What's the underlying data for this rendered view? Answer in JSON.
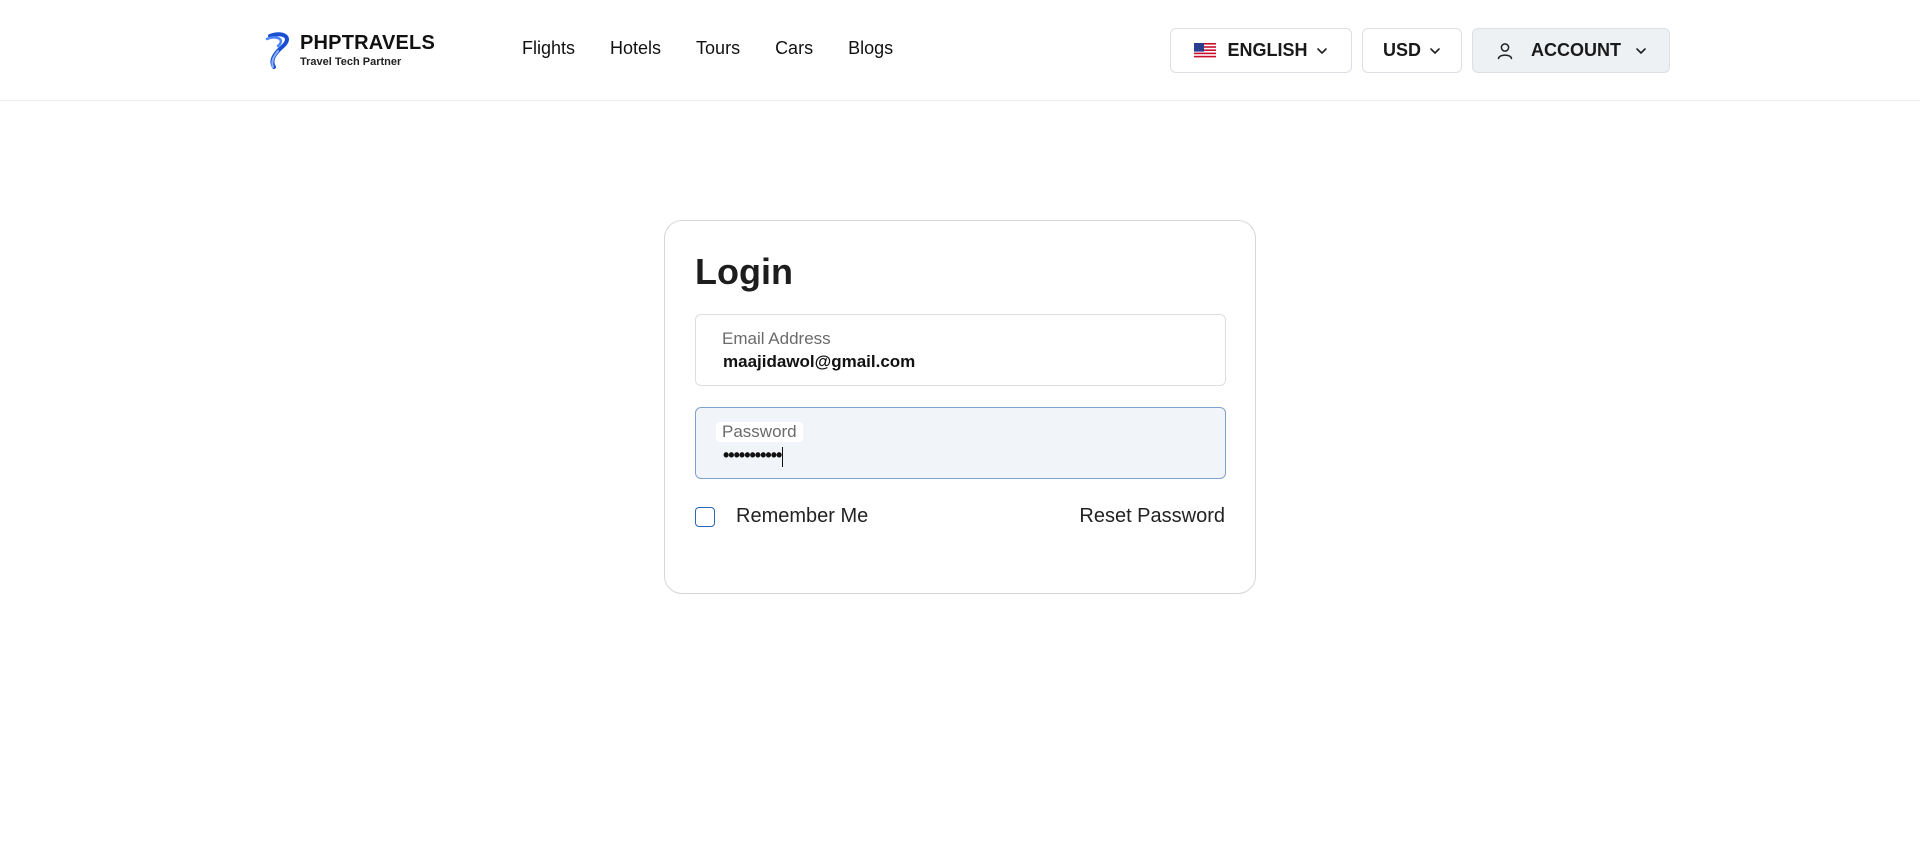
{
  "header": {
    "logo": {
      "name": "PHPTRAVELS",
      "tagline": "Travel Tech Partner"
    },
    "nav": [
      {
        "label": "Flights"
      },
      {
        "label": "Hotels"
      },
      {
        "label": "Tours"
      },
      {
        "label": "Cars"
      },
      {
        "label": "Blogs"
      }
    ],
    "language": {
      "label": "ENGLISH",
      "icon": "us-flag-icon"
    },
    "currency": {
      "label": "USD"
    },
    "account": {
      "label": "ACCOUNT",
      "icon": "user-icon"
    }
  },
  "login": {
    "title": "Login",
    "email": {
      "label": "Email Address",
      "value": "maajidawol@gmail.com"
    },
    "password": {
      "label": "Password",
      "masked_value": "•••••••••••"
    },
    "remember_label": "Remember Me",
    "reset_label": "Reset Password"
  },
  "colors": {
    "accent": "#2c65b8",
    "focus_border": "#7fa2cc",
    "focus_bg": "#f1f5f9",
    "account_bg": "#eef1f4"
  }
}
